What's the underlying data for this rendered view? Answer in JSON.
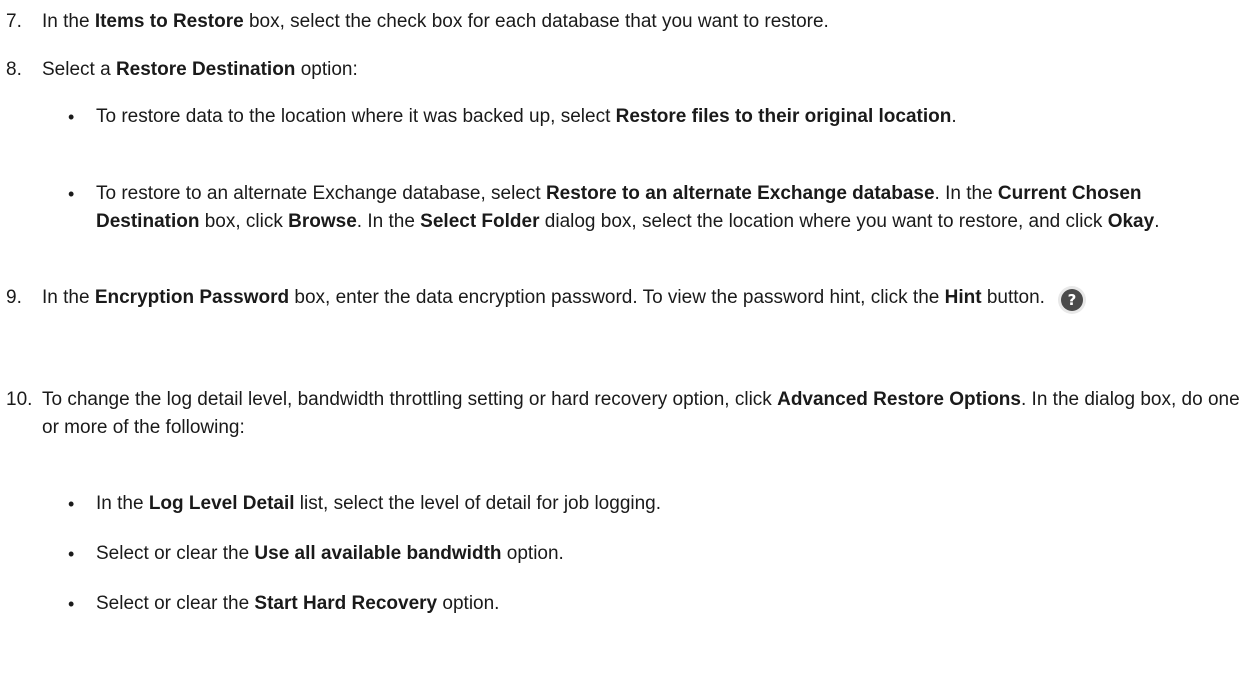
{
  "steps": [
    {
      "num": "7.",
      "t1": "In the ",
      "b1": "Items to Restore",
      "t2": " box, select the check box for each database that you want to restore."
    },
    {
      "num": "8.",
      "t1": "Select a ",
      "b1": "Restore Destination",
      "t2": " option:"
    },
    {
      "num": "9.",
      "t1": "In the ",
      "b1": "Encryption Password",
      "t2": " box, enter the data encryption password. To view the password hint, click the ",
      "b2": "Hint",
      "t3": " button.",
      "icon": "help-question-icon"
    },
    {
      "num": "10.",
      "t1": "To change the log detail level, bandwidth throttling setting or hard recovery option, click ",
      "b1": "Advanced Restore Options",
      "t2": ". In the dialog box, do one or more of the following:"
    }
  ],
  "bullets8": [
    {
      "t1": "To restore data to the location where it was backed up, select ",
      "b1": "Restore files to their original location",
      "t2": "."
    },
    {
      "t1": "To restore to an alternate Exchange database, select ",
      "b1": "Restore to an alternate Exchange database",
      "t2": ". In the ",
      "b2": "Current Chosen Destination",
      "t3": " box, click ",
      "b3": "Browse",
      "t4": ". In the ",
      "b4": "Select Folder",
      "t5": " dialog box, select the location where you want to restore, and click ",
      "b5": "Okay",
      "t6": "."
    }
  ],
  "bullets10": [
    {
      "t1": "In the ",
      "b1": "Log Level Detail",
      "t2": " list, select the level of detail for job logging."
    },
    {
      "t1": "Select or clear the ",
      "b1": "Use all available bandwidth",
      "t2": " option."
    },
    {
      "t1": "Select or clear the ",
      "b1": "Start Hard Recovery",
      "t2": " option."
    }
  ],
  "bullet_glyph": "•",
  "hint_icon_glyph": "?"
}
